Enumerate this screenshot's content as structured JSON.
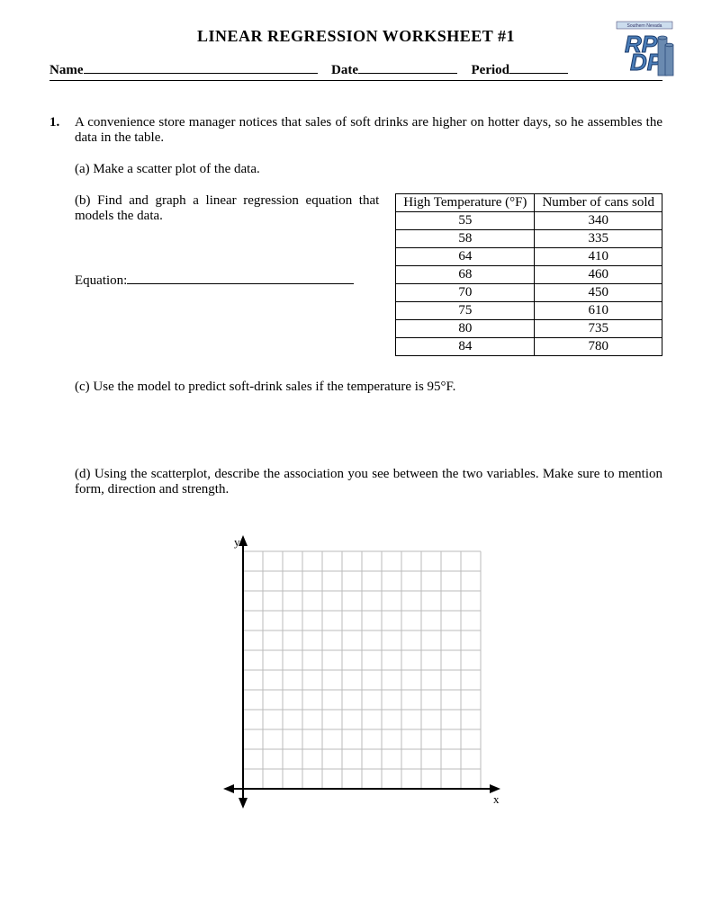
{
  "title": "LINEAR REGRESSION WORKSHEET #1",
  "header": {
    "name_label": "Name",
    "date_label": "Date",
    "period_label": "Period"
  },
  "logo": {
    "top_text": "Southern Nevada",
    "line1": "RP",
    "line2": "DP"
  },
  "question": {
    "number": "1.",
    "intro": "A convenience store manager notices that sales of soft drinks are higher on hotter days, so he assembles the data in the table.",
    "part_a": "(a)  Make a scatter plot of the data.",
    "part_b": "(b) Find and graph a linear regression equation that models the data.",
    "equation_label": "Equation:",
    "part_c": "(c)  Use the model to predict soft-drink sales if the temperature is 95°F.",
    "part_d": "(d)  Using the scatterplot, describe the association you see between the two variables.  Make sure to mention form, direction and strength."
  },
  "table": {
    "headers": [
      "High Temperature (°F)",
      "Number of cans sold"
    ],
    "rows": [
      [
        "55",
        "340"
      ],
      [
        "58",
        "335"
      ],
      [
        "64",
        "410"
      ],
      [
        "68",
        "460"
      ],
      [
        "70",
        "450"
      ],
      [
        "75",
        "610"
      ],
      [
        "80",
        "735"
      ],
      [
        "84",
        "780"
      ]
    ]
  },
  "chart_data": {
    "type": "scatter",
    "title": "",
    "xlabel": "x",
    "ylabel": "y",
    "x": [],
    "y": [],
    "grid": true,
    "grid_cells": 12
  }
}
